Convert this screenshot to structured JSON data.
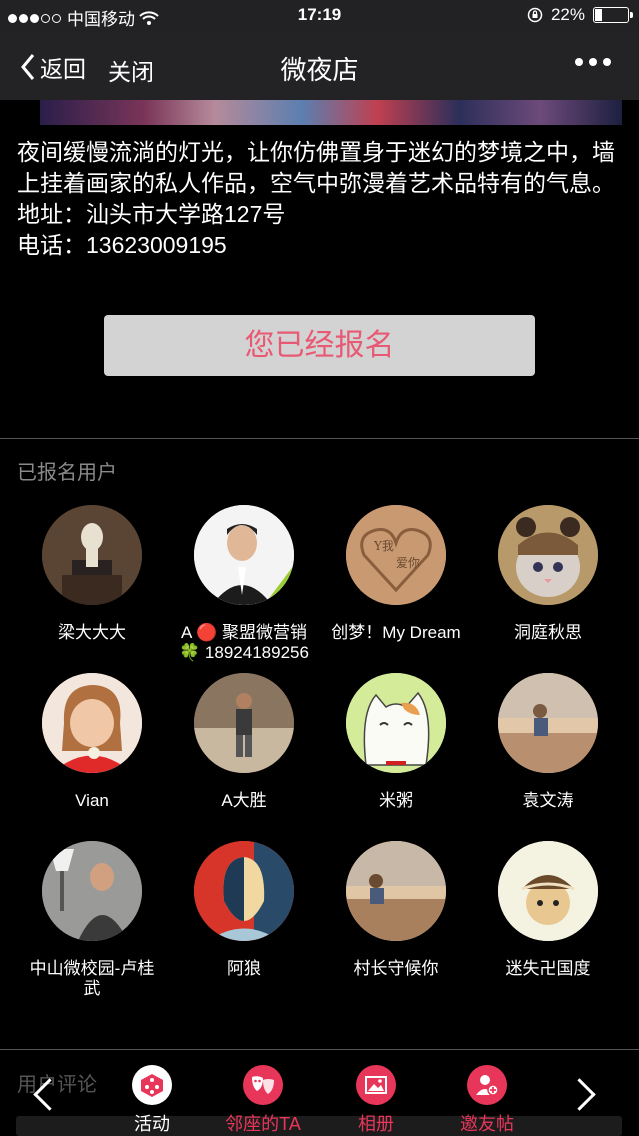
{
  "status_bar": {
    "carrier": "中国移动",
    "time": "17:19",
    "battery": "22%",
    "battery_level": 0.22
  },
  "nav": {
    "back_label": "返回",
    "close_label": "关闭",
    "title": "微夜店"
  },
  "description": {
    "text": "夜间缓慢流淌的灯光，让你仿佛置身于迷幻的梦境之中，墙上挂着画家的私人作品，空气中弥漫着艺术品特有的气息。",
    "address": "地址：汕头市大学路127号",
    "phone": "电话：13623009195"
  },
  "signup_button": "您已经报名",
  "registered": {
    "label": "已报名用户",
    "users": [
      {
        "name": "梁大大大"
      },
      {
        "name": "A 🔴 聚盟微营销 🍀 18924189256"
      },
      {
        "name": "创梦！My Dream"
      },
      {
        "name": "洞庭秋思"
      },
      {
        "name": "Vian"
      },
      {
        "name": "A大胜"
      },
      {
        "name": "米粥"
      },
      {
        "name": "袁文涛"
      },
      {
        "name": "中山微校园-卢桂武"
      },
      {
        "name": "阿狼"
      },
      {
        "name": "村长守候你"
      },
      {
        "name": "迷失卍国度"
      }
    ]
  },
  "comments_label": "用户评论",
  "bottom_tabs": [
    {
      "label": "活动",
      "icon": "dice-icon",
      "color": "#ffffff"
    },
    {
      "label": "邻座的TA",
      "icon": "mask-icon",
      "color": "#e8365a"
    },
    {
      "label": "相册",
      "icon": "image-icon",
      "color": "#e8365a"
    },
    {
      "label": "邀友帖",
      "icon": "add-friend-icon",
      "color": "#e8365a"
    }
  ],
  "colors": {
    "accent": "#e8365a",
    "signup_text": "#e85a74",
    "background": "#000000"
  }
}
